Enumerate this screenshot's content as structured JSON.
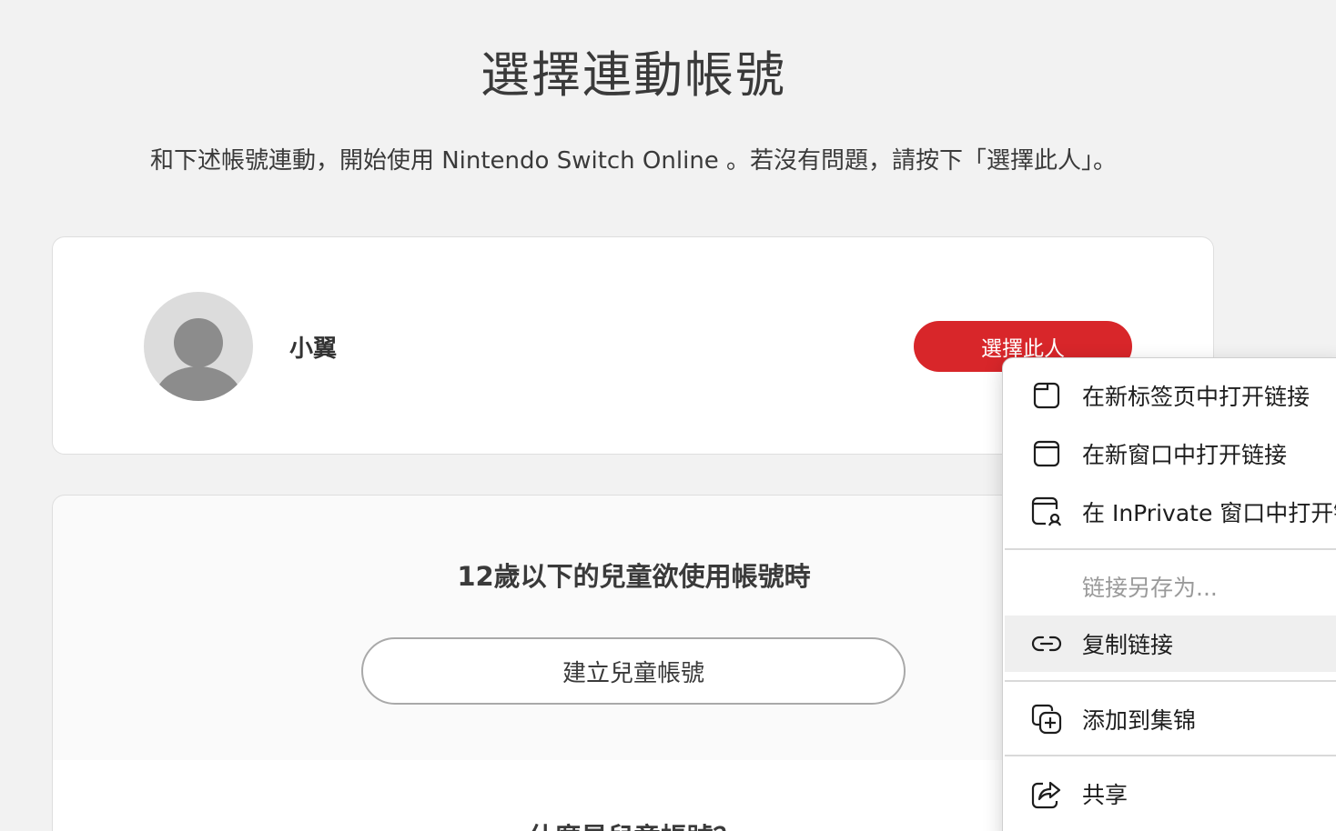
{
  "page": {
    "title": "選擇連動帳號",
    "subtitle": "和下述帳號連動，開始使用 Nintendo Switch Online 。若沒有問題，請按下「選擇此人」。"
  },
  "user_card": {
    "name": "小翼",
    "select_button": "選擇此人"
  },
  "child_card": {
    "heading": "12歲以下的兒童欲使用帳號時",
    "create_button": "建立兒童帳號",
    "lower_heading": "什麼是兒童帳號？"
  },
  "context_menu": {
    "items": [
      {
        "label": "在新标签页中打开链接",
        "icon": "new-tab-icon"
      },
      {
        "label": "在新窗口中打开链接",
        "icon": "new-window-icon"
      },
      {
        "label": "在 InPrivate 窗口中打开链接",
        "icon": "inprivate-window-icon"
      },
      {
        "label": "链接另存为...",
        "icon": ""
      },
      {
        "label": "复制链接",
        "icon": "link-icon"
      },
      {
        "label": "添加到集锦",
        "icon": "collections-add-icon"
      },
      {
        "label": "共享",
        "icon": "share-icon"
      }
    ]
  },
  "colors": {
    "background": "#f2f2f2",
    "accent": "#d8262a",
    "menu_highlight": "#efefef"
  }
}
